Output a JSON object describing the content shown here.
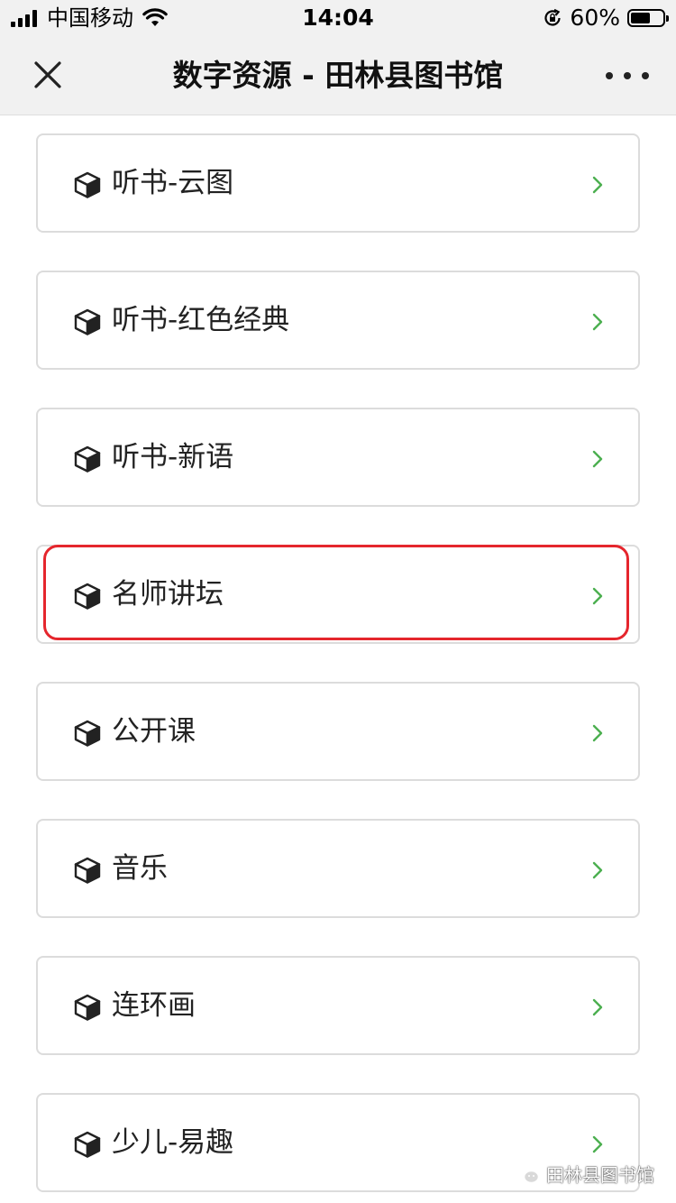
{
  "status_bar": {
    "carrier": "中国移动",
    "time": "14:04",
    "battery_percent": "60%",
    "battery_level": 0.6,
    "icons": [
      "signal-icon",
      "wifi-icon",
      "rotation-lock-icon",
      "battery-icon"
    ]
  },
  "nav": {
    "title": "数字资源 - 田林县图书馆",
    "close_icon": "close-icon",
    "more_icon": "more-icon"
  },
  "list": {
    "item_icon": "cube-icon",
    "chevron_color": "#4caf50",
    "highlight_color": "#e5262d",
    "highlighted_item": "名师讲坛",
    "items": [
      {
        "label": "听书-云图"
      },
      {
        "label": "听书-红色经典"
      },
      {
        "label": "听书-新语"
      },
      {
        "label": "名师讲坛"
      },
      {
        "label": "公开课"
      },
      {
        "label": "音乐"
      },
      {
        "label": "连环画"
      },
      {
        "label": "少儿-易趣"
      }
    ]
  },
  "watermark": {
    "text": "田林县图书馆",
    "icon": "wechat-icon"
  }
}
